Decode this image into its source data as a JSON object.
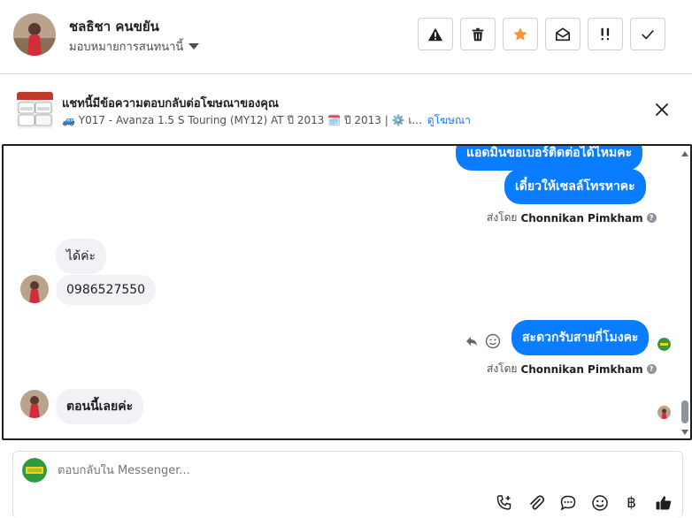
{
  "header": {
    "contact_name": "ชลธิชา คนขยัน",
    "assign_label": "มอบหมายการสนทนานี้",
    "actions": [
      {
        "icon": "warning-icon"
      },
      {
        "icon": "trash-icon"
      },
      {
        "icon": "star-icon",
        "color": "#f7923b"
      },
      {
        "icon": "envelope-open-icon"
      },
      {
        "icon": "double-exclamation-icon"
      },
      {
        "icon": "checkmark-icon"
      }
    ]
  },
  "ad_banner": {
    "title": "แชทนี้มีข้อความตอบกลับต่อโฆษณาของคุณ",
    "subtitle": "🚙 Y017 - Avanza 1.5 S Touring (MY12) AT ปี 2013 🗓️ ปี 2013 | ⚙️ เ...",
    "link": "ดูโฆษณา"
  },
  "messages": {
    "out_1_partial": "แอดมินขอเบอร์ติดต่อได้ไหมคะ",
    "out_2": "เดี๋ยวให้เซลล์โทรหาคะ",
    "sent_by_1_prefix": "ส่งโดย",
    "sent_by_1_name": "Chonnikan Pimkham",
    "in_1": "ได้ค่ะ",
    "in_2": "0986527550",
    "out_3": "สะดวกรับสายกี่โมงคะ",
    "sent_by_2_prefix": "ส่งโดย",
    "sent_by_2_name": "Chonnikan Pimkham",
    "in_3": "ตอนนี้เลยค่ะ"
  },
  "composer": {
    "placeholder": "ตอบกลับใน Messenger..."
  },
  "colors": {
    "accent": "#0a7cff",
    "star": "#f7923b",
    "incoming_bubble": "#f0f2f5"
  }
}
